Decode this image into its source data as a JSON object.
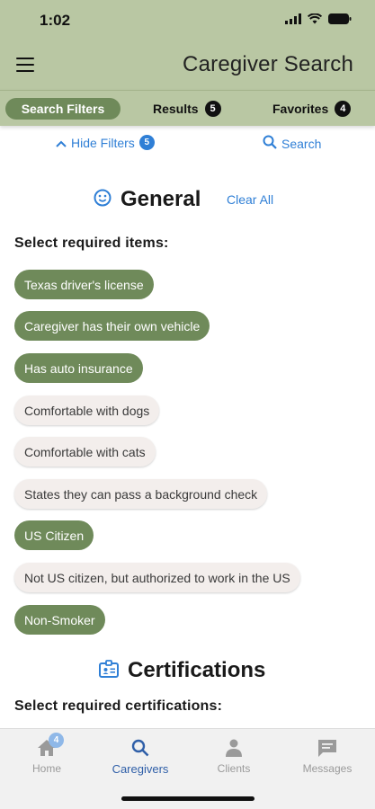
{
  "status": {
    "time": "1:02"
  },
  "header": {
    "title": "Caregiver Search"
  },
  "tabs": [
    {
      "label": "Search Filters",
      "active": true
    },
    {
      "label": "Results",
      "count": "5"
    },
    {
      "label": "Favorites",
      "count": "4"
    }
  ],
  "filter_bar": {
    "hide_label": "Hide Filters",
    "hide_count": "5",
    "search_label": "Search"
  },
  "general": {
    "title": "General",
    "clear_all": "Clear All",
    "prompt": "Select required items:",
    "items": [
      {
        "label": "Texas driver's license",
        "selected": true
      },
      {
        "label": "Caregiver has their own vehicle",
        "selected": true
      },
      {
        "label": "Has auto insurance",
        "selected": true
      },
      {
        "label": "Comfortable with dogs",
        "selected": false
      },
      {
        "label": "Comfortable with cats",
        "selected": false
      },
      {
        "label": "States they can pass a background check",
        "selected": false
      },
      {
        "label": "US Citizen",
        "selected": true
      },
      {
        "label": "Not US citizen, but authorized to work in the US",
        "selected": false
      },
      {
        "label": "Non-Smoker",
        "selected": true
      }
    ]
  },
  "certifications": {
    "title": "Certifications",
    "prompt": "Select required certifications:"
  },
  "bottom_nav": [
    {
      "label": "Home",
      "icon": "home-icon",
      "badge": "4"
    },
    {
      "label": "Caregivers",
      "icon": "search-icon",
      "active": true
    },
    {
      "label": "Clients",
      "icon": "person-icon"
    },
    {
      "label": "Messages",
      "icon": "message-icon"
    }
  ],
  "colors": {
    "header_bg": "#b9c7a3",
    "chip_selected": "#6f8a5a",
    "chip_unselected": "#f3eeec",
    "link_blue": "#2f7fd6",
    "nav_active": "#2f5fa8"
  }
}
